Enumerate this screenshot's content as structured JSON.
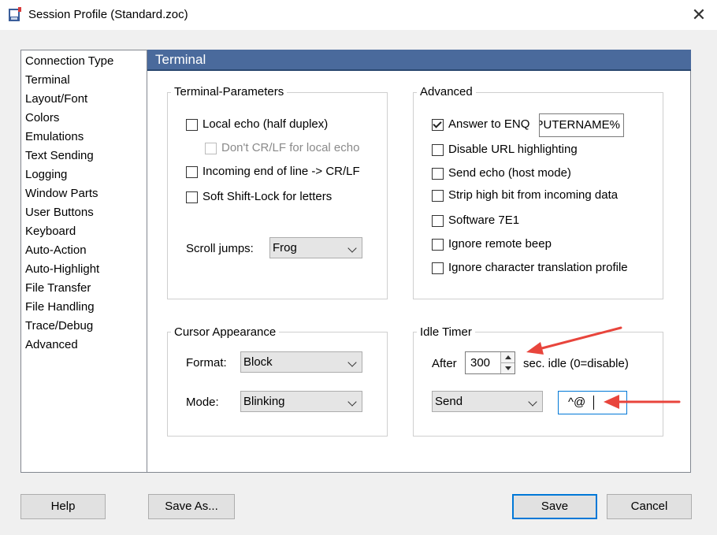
{
  "window": {
    "title": "Session Profile (Standard.zoc)",
    "close_glyph": "✕"
  },
  "sidebar": {
    "items": [
      "Connection Type",
      "Terminal",
      "Layout/Font",
      "Colors",
      "Emulations",
      "Text Sending",
      "Logging",
      "Window Parts",
      "User Buttons",
      "Keyboard",
      "Auto-Action",
      "Auto-Highlight",
      "File Transfer",
      "File Handling",
      "Trace/Debug",
      "Advanced"
    ],
    "selected": "Terminal"
  },
  "panel": {
    "title": "Terminal",
    "header_color": "#4a6a9c"
  },
  "terminal_params": {
    "label": "Terminal-Parameters",
    "local_echo": "Local echo (half duplex)",
    "no_crlf": "Don't CR/LF for local echo",
    "incoming_eol": "Incoming end of line -> CR/LF",
    "soft_shift": "Soft Shift-Lock for letters",
    "scroll_label": "Scroll jumps:",
    "scroll_value": "Frog"
  },
  "advanced": {
    "label": "Advanced",
    "answer_enq": "Answer to ENQ",
    "enq_value": "COMPUTERNAME%",
    "disable_url": "Disable URL highlighting",
    "send_echo": "Send echo (host mode)",
    "strip_high": "Strip high bit from incoming data",
    "software_7e1": "Software 7E1",
    "ignore_beep": "Ignore remote beep",
    "ignore_translation": "Ignore character translation profile"
  },
  "cursor": {
    "label": "Cursor Appearance",
    "format_label": "Format:",
    "format_value": "Block",
    "mode_label": "Mode:",
    "mode_value": "Blinking"
  },
  "idle": {
    "label": "Idle Timer",
    "after_label": "After",
    "seconds": "300",
    "suffix": "sec. idle (0=disable)",
    "action_value": "Send",
    "send_text": "^@"
  },
  "buttons": {
    "help": "Help",
    "save_as": "Save As...",
    "save": "Save",
    "cancel": "Cancel"
  },
  "colors": {
    "annotation_arrow": "#e8453c",
    "default_button_border": "#0078d7"
  }
}
